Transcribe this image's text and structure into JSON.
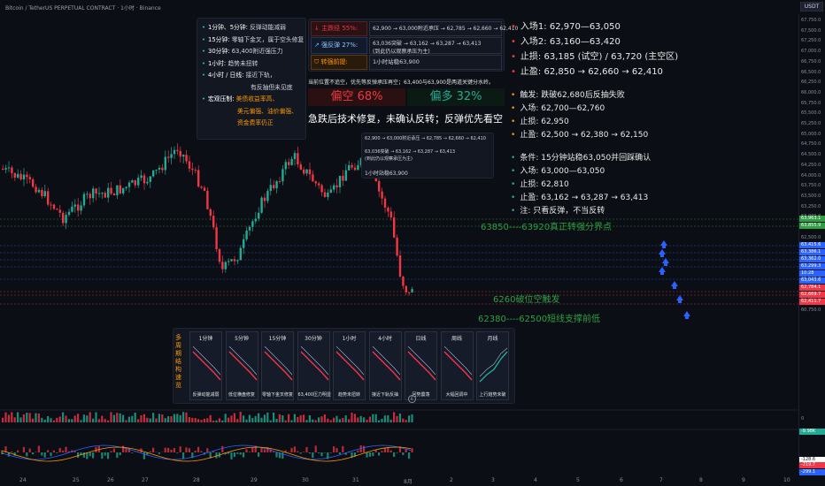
{
  "topbar": {
    "symbol": "Bitcoin / TetherUS PERPETUAL CONTRACT · 1小时 · Binance"
  },
  "price_axis": {
    "currency": "USDT",
    "ticks": [
      "67,750.0",
      "67,500.0",
      "67,250.0",
      "67,000.0",
      "66,750.0",
      "66,500.0",
      "66,250.0",
      "66,000.0",
      "65,750.0",
      "65,500.0",
      "65,250.0",
      "65,000.0",
      "64,750.0",
      "64,500.0",
      "64,250.0",
      "64,000.0",
      "63,750.0",
      "63,500.0",
      "63,250.0",
      "63,000.0",
      "62,750.0",
      "62,500.0",
      "62,250.0",
      "62,000.0",
      "61,750.0",
      "61,500.0",
      "61,250.0",
      "61,000.0",
      "60,750.0"
    ],
    "tags": [
      {
        "text": "63,963.1",
        "color": "#2ea043"
      },
      {
        "text": "63,855.9",
        "color": "#2ea043"
      },
      {
        "text": "63,415.6",
        "color": "#2962ff"
      },
      {
        "text": "63,386.1",
        "color": "#2962ff"
      },
      {
        "text": "63,362.0",
        "color": "#2962ff"
      },
      {
        "text": "63,299.3",
        "color": "#2962ff"
      },
      {
        "text": "10:28",
        "color": "#2962ff"
      },
      {
        "text": "63,043.6",
        "color": "#2962ff"
      },
      {
        "text": "62,784.1",
        "color": "#f23645"
      },
      {
        "text": "62,669.7",
        "color": "#f23645"
      },
      {
        "text": "62,411.7",
        "color": "#f23645"
      }
    ],
    "osc_tags": [
      "0",
      "-9.98K",
      "-128.6",
      "-219.7",
      "-299.1"
    ]
  },
  "time_axis": [
    "24",
    "25",
    "26",
    "27",
    "28",
    "29",
    "30",
    "31",
    "8月",
    "2",
    "3",
    "4",
    "5",
    "6",
    "7",
    "8",
    "9",
    "10"
  ],
  "left_notes": [
    {
      "k": "1分钟、5分钟:",
      "v": "反弹动能减弱"
    },
    {
      "k": "15分钟:",
      "v": "零轴下金叉，属于空头修复"
    },
    {
      "k": "30分钟:",
      "v": "63,400附近强压力"
    },
    {
      "k": "1小时:",
      "v": "趋势未扭转"
    },
    {
      "k": "4小时 / 日线:",
      "v": "接近下轨，"
    },
    {
      "k": "",
      "v": "有反抽但未见底"
    },
    {
      "k": "宏观压制:",
      "v": "美债收益率高、"
    },
    {
      "k": "",
      "v": "美元偏强、油价偏强、"
    },
    {
      "k": "",
      "v": "资金费率仍正"
    }
  ],
  "scenarios": [
    {
      "icon": "down-arrow-icon",
      "name": "主跌径 55%:",
      "path": "62,900 → 63,000附近承压 → 62,785 → 62,660 → 62,410"
    },
    {
      "icon": "up-arrow-icon",
      "name": "强反弹 27%:",
      "path": "63,036突破 → 63,162 → 63,287 → 63,413",
      "note": "(到此仍以观察承压为主)"
    },
    {
      "icon": "shield-icon",
      "name": "转强前提:",
      "path": "1小时站稳63,900"
    }
  ],
  "position_note": "当前位置不追空，优先等反弹承压再空；63,400与63,900是两道关键分水岭。",
  "bias": {
    "short": "偏空 68%",
    "long": "偏多 32%"
  },
  "headline": "急跌后技术修复，未确认反转；反弹优先看空",
  "mid_box": [
    "62,900 → 63,000附近承压 → 62,785 → 62,660 → 62,410",
    "63,036突破 → 63,162 → 63,287 → 63,413",
    "(到此仍以观察承压为主)",
    "1小时站稳63,900"
  ],
  "plan_a": [
    {
      "k": "入场1:",
      "v": "62,970—63,050"
    },
    {
      "k": "入场2:",
      "v": "63,160—63,420"
    },
    {
      "k": "止损:",
      "v": "63,185 (试空) / 63,720 (主空区)"
    },
    {
      "k": "止盈:",
      "v": "62,850 → 62,660 → 62,410"
    }
  ],
  "plan_b": [
    {
      "k": "触发:",
      "v": "跌破62,680后反抽失败"
    },
    {
      "k": "入场:",
      "v": "62,700—62,760"
    },
    {
      "k": "止损:",
      "v": "62,950"
    },
    {
      "k": "止盈:",
      "v": "62,500 → 62,380 → 62,150"
    }
  ],
  "plan_c": [
    {
      "k": "条件:",
      "v": "15分钟站稳63,050并回踩确认"
    },
    {
      "k": "入场:",
      "v": "63,000—63,050"
    },
    {
      "k": "止损:",
      "v": "62,810"
    },
    {
      "k": "止盈:",
      "v": "63,162 → 63,287 → 63,413"
    },
    {
      "k": "注:",
      "v": "只看反弹，不当反转"
    }
  ],
  "zones": {
    "z1": "63850----63920真正转强分界点",
    "z2": "6260破位空触发",
    "z3": "62380----62500短线支撑前低"
  },
  "structure": {
    "title": "多周期结构速览",
    "cards": [
      {
        "t": "1分钟",
        "b": "反弹动能减弱"
      },
      {
        "t": "5分钟",
        "b": "低位横盘修复"
      },
      {
        "t": "15分钟",
        "b": "零轴下金叉修复"
      },
      {
        "t": "30分钟",
        "b": "63,400压力明显"
      },
      {
        "t": "1小时",
        "b": "趋势未扭转"
      },
      {
        "t": "4小时",
        "b": "接近下轨反抽"
      },
      {
        "t": "日线",
        "b": "回势震荡"
      },
      {
        "t": "周线",
        "b": "大幅回调中"
      },
      {
        "t": "月线",
        "b": "上行趋势未破"
      }
    ]
  },
  "colors": {
    "up": "#22ab94",
    "down": "#f23645",
    "bg": "#0b0e14",
    "accent_blue": "#2962ff",
    "zone_green": "#2ea043"
  }
}
